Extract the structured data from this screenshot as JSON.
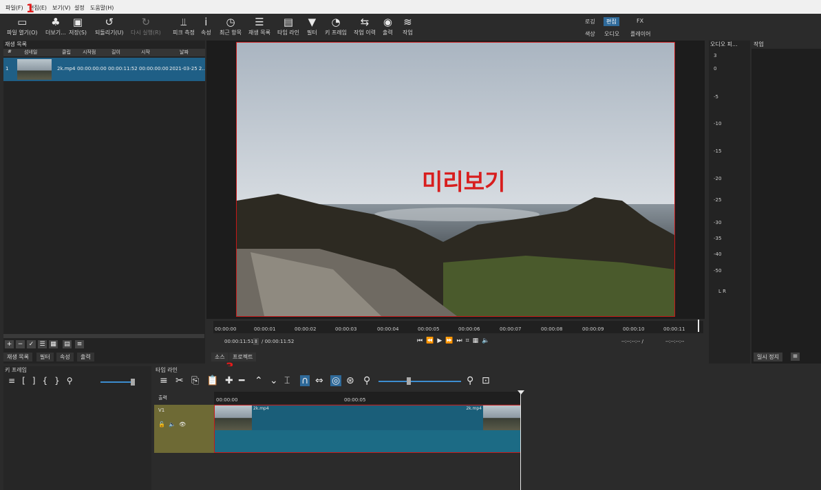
{
  "menubar": {
    "items": [
      "파일(F)",
      "편집(E)",
      "보기(V)",
      "설정",
      "도움말(H)"
    ]
  },
  "toolbar": {
    "items": [
      {
        "label": "파일 열기(O)",
        "icon": "folder-open-icon"
      },
      {
        "label": "더보기...",
        "icon": "open-other-icon"
      },
      {
        "label": "저장(S)",
        "icon": "save-icon"
      },
      {
        "label": "되돌리기(U)",
        "icon": "undo-icon"
      },
      {
        "label": "다시 실행(R)",
        "icon": "redo-icon"
      },
      {
        "label": "피크 측정",
        "icon": "peak-meter-icon"
      },
      {
        "label": "속성",
        "icon": "info-icon"
      },
      {
        "label": "최근 항목",
        "icon": "clock-icon"
      },
      {
        "label": "재생 목록",
        "icon": "list-icon"
      },
      {
        "label": "타임 라인",
        "icon": "timeline-icon"
      },
      {
        "label": "필터",
        "icon": "filter-icon"
      },
      {
        "label": "키 프레임",
        "icon": "stopwatch-icon"
      },
      {
        "label": "작업 이력",
        "icon": "history-icon"
      },
      {
        "label": "출력",
        "icon": "export-icon"
      },
      {
        "label": "작업",
        "icon": "jobs-icon"
      }
    ],
    "layouts": {
      "row1": [
        "로깅",
        "편집",
        "FX"
      ],
      "row2": [
        "색상",
        "오디오",
        "플레이어"
      ],
      "selected": "편집"
    }
  },
  "playlist": {
    "title": "재생 목록",
    "columns": [
      "#",
      "섬네일",
      "클립",
      "시작점",
      "길이",
      "시작",
      "날짜"
    ],
    "rows": [
      {
        "num": "1",
        "clip": "2k.mp4",
        "in": "00:00:00:00",
        "duration": "00:00:11:52",
        "start": "00:00:00:00",
        "date": "2021-03-25 2..."
      }
    ],
    "tabs": [
      "재생 목록",
      "필터",
      "속성",
      "출력"
    ]
  },
  "preview": {
    "overlay_text": "미리보기",
    "ruler_labels": [
      "00:00:00",
      "00:00:01",
      "00:00:02",
      "00:00:03",
      "00:00:04",
      "00:00:05",
      "00:00:06",
      "00:00:07",
      "00:00:08",
      "00:00:09",
      "00:00:10",
      "00:00:11"
    ],
    "position": "00:00:11:51",
    "duration": "/ 00:00:11:52",
    "in_out_a": "--:--:--:-- /",
    "in_out_b": "--:--:--:--",
    "tabs": [
      "소스",
      "프로젝트"
    ]
  },
  "audio_meter": {
    "title": "오디오 피...",
    "scale": [
      "3",
      "0",
      "-5",
      "-10",
      "-15",
      "-20",
      "-25",
      "-30",
      "-35",
      "-40",
      "-50"
    ],
    "channels": "L R"
  },
  "jobs": {
    "title": "작업",
    "pause_label": "일시 정지"
  },
  "keyframes": {
    "title": "키 프레임"
  },
  "timeline": {
    "title": "타임 라인",
    "output_label": "출력",
    "ruler": [
      "00:00:00",
      "00:00:05"
    ],
    "track": "V1",
    "clip_label_start": "2k.mp4",
    "clip_label_end": "2k.mp4"
  },
  "annotations": {
    "mark1": "1",
    "mark2": "2",
    "mark3": "3"
  }
}
